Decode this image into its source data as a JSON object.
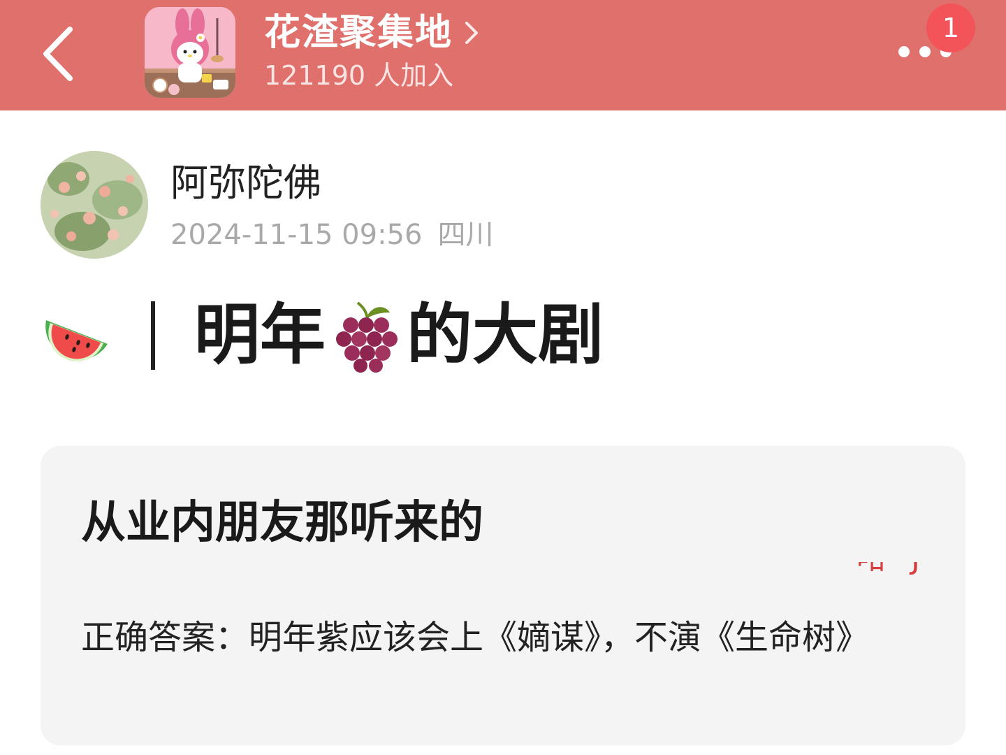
{
  "header": {
    "back_label": "<",
    "group_name": "花渣聚集地",
    "member_count": "121190 人加入",
    "notification_count": "1"
  },
  "post": {
    "author_name": "阿弥陀佛",
    "date": "2024-11-15 09:56",
    "location": "四川",
    "title_before": "明年",
    "title_after": "的大剧",
    "title_icons": [
      "watermelon-icon",
      "grapes-icon"
    ]
  },
  "card": {
    "headline": "从业内朋友那听来的",
    "fragment": "咁 J",
    "answer": "正确答案：明年紫应该会上《嫡谋》，不演《生命树》"
  },
  "colors": {
    "header_bg": "#e0706c",
    "badge_bg": "#f2545a",
    "card_bg": "#f4f4f4",
    "meta_text": "#a9a9a9"
  }
}
